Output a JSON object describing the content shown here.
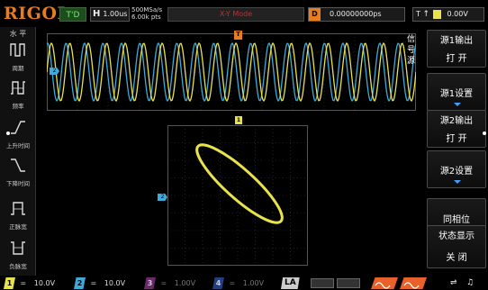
{
  "topbar": {
    "logo": "RIGOL",
    "trigger_status": "T'D",
    "hbase_label": "H",
    "hbase_value": "1.00us",
    "sample_rate": "500MSa/s",
    "memory_depth": "6.00k pts",
    "mode": "X-Y Mode",
    "delay_label": "D",
    "delay_value": "0.00000000ps",
    "trigger_label": "T",
    "trigger_level": "0.00V"
  },
  "left_menu": {
    "title": "水 平",
    "items": [
      {
        "label": "周期",
        "icon": "period-icon"
      },
      {
        "label": "频率",
        "icon": "frequency-icon"
      },
      {
        "label": "上升时间",
        "icon": "rise-time-icon"
      },
      {
        "label": "下降时间",
        "icon": "fall-time-icon"
      },
      {
        "label": "正脉宽",
        "icon": "positive-width-icon"
      },
      {
        "label": "负脉宽",
        "icon": "negative-width-icon"
      }
    ]
  },
  "right_menu": {
    "side_title": "信号源",
    "buttons": [
      {
        "head": "源1输出",
        "value": "打 开"
      },
      {
        "head": "源1设置",
        "value": ""
      },
      {
        "head": "源2输出",
        "value": "打 开"
      },
      {
        "head": "源2设置",
        "value": ""
      },
      {
        "head": "",
        "value": "同相位"
      },
      {
        "head": "状态显示",
        "value": "关 闭"
      }
    ]
  },
  "markers": {
    "ch2": "2",
    "trigger_pos": "T",
    "ch1_level": "1"
  },
  "channels": [
    {
      "num": "1",
      "coupling": "=",
      "scale": "10.0V",
      "color": "#e9e34b"
    },
    {
      "num": "2",
      "coupling": "=",
      "scale": "10.0V",
      "color": "#3fa9d9"
    },
    {
      "num": "3",
      "coupling": "=",
      "scale": "1.00V",
      "color": "#c050c0"
    },
    {
      "num": "4",
      "coupling": "=",
      "scale": "1.00V",
      "color": "#3060d0"
    }
  ],
  "bottom": {
    "la_label": "LA"
  },
  "colors": {
    "ch1": "#e9e34b",
    "ch2": "#3fa9d9",
    "accent": "#e87c1e"
  }
}
